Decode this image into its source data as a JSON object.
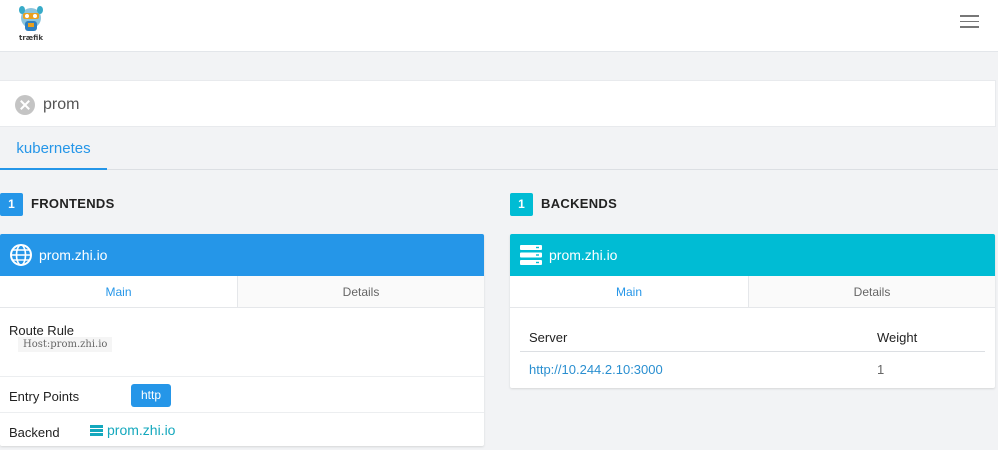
{
  "app": {
    "logo_text": "træfik"
  },
  "search": {
    "value": "prom"
  },
  "providers": [
    {
      "label": "kubernetes"
    }
  ],
  "frontends": {
    "count": "1",
    "title": "FRONTENDS",
    "color": "#2596e8",
    "card": {
      "name": "prom.zhi.io",
      "icon": "globe-icon",
      "tabs": [
        "Main",
        "Details"
      ],
      "route_rule_label": "Route Rule",
      "route_rule_value": "Host:prom.zhi.io",
      "entry_points_label": "Entry Points",
      "entry_point": "http",
      "backend_label": "Backend",
      "backend_value": "prom.zhi.io"
    }
  },
  "backends": {
    "count": "1",
    "title": "BACKENDS",
    "color": "#00bcd4",
    "card": {
      "name": "prom.zhi.io",
      "icon": "server-icon",
      "tabs": [
        "Main",
        "Details"
      ],
      "columns": [
        "Server",
        "Weight"
      ],
      "rows": [
        {
          "server": "http://10.244.2.10:3000",
          "weight": "1"
        }
      ]
    }
  }
}
